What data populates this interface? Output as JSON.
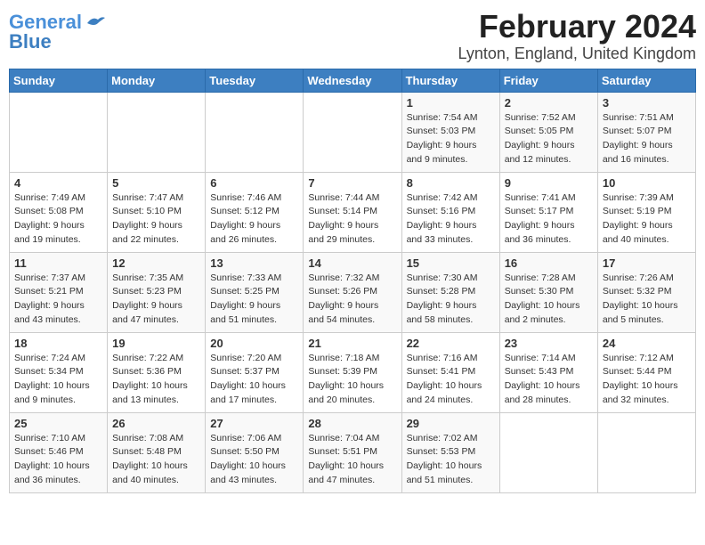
{
  "logo": {
    "line1": "General",
    "line2": "Blue"
  },
  "title": "February 2024",
  "location": "Lynton, England, United Kingdom",
  "days_of_week": [
    "Sunday",
    "Monday",
    "Tuesday",
    "Wednesday",
    "Thursday",
    "Friday",
    "Saturday"
  ],
  "weeks": [
    [
      {
        "day": "",
        "info": ""
      },
      {
        "day": "",
        "info": ""
      },
      {
        "day": "",
        "info": ""
      },
      {
        "day": "",
        "info": ""
      },
      {
        "day": "1",
        "info": "Sunrise: 7:54 AM\nSunset: 5:03 PM\nDaylight: 9 hours\nand 9 minutes."
      },
      {
        "day": "2",
        "info": "Sunrise: 7:52 AM\nSunset: 5:05 PM\nDaylight: 9 hours\nand 12 minutes."
      },
      {
        "day": "3",
        "info": "Sunrise: 7:51 AM\nSunset: 5:07 PM\nDaylight: 9 hours\nand 16 minutes."
      }
    ],
    [
      {
        "day": "4",
        "info": "Sunrise: 7:49 AM\nSunset: 5:08 PM\nDaylight: 9 hours\nand 19 minutes."
      },
      {
        "day": "5",
        "info": "Sunrise: 7:47 AM\nSunset: 5:10 PM\nDaylight: 9 hours\nand 22 minutes."
      },
      {
        "day": "6",
        "info": "Sunrise: 7:46 AM\nSunset: 5:12 PM\nDaylight: 9 hours\nand 26 minutes."
      },
      {
        "day": "7",
        "info": "Sunrise: 7:44 AM\nSunset: 5:14 PM\nDaylight: 9 hours\nand 29 minutes."
      },
      {
        "day": "8",
        "info": "Sunrise: 7:42 AM\nSunset: 5:16 PM\nDaylight: 9 hours\nand 33 minutes."
      },
      {
        "day": "9",
        "info": "Sunrise: 7:41 AM\nSunset: 5:17 PM\nDaylight: 9 hours\nand 36 minutes."
      },
      {
        "day": "10",
        "info": "Sunrise: 7:39 AM\nSunset: 5:19 PM\nDaylight: 9 hours\nand 40 minutes."
      }
    ],
    [
      {
        "day": "11",
        "info": "Sunrise: 7:37 AM\nSunset: 5:21 PM\nDaylight: 9 hours\nand 43 minutes."
      },
      {
        "day": "12",
        "info": "Sunrise: 7:35 AM\nSunset: 5:23 PM\nDaylight: 9 hours\nand 47 minutes."
      },
      {
        "day": "13",
        "info": "Sunrise: 7:33 AM\nSunset: 5:25 PM\nDaylight: 9 hours\nand 51 minutes."
      },
      {
        "day": "14",
        "info": "Sunrise: 7:32 AM\nSunset: 5:26 PM\nDaylight: 9 hours\nand 54 minutes."
      },
      {
        "day": "15",
        "info": "Sunrise: 7:30 AM\nSunset: 5:28 PM\nDaylight: 9 hours\nand 58 minutes."
      },
      {
        "day": "16",
        "info": "Sunrise: 7:28 AM\nSunset: 5:30 PM\nDaylight: 10 hours\nand 2 minutes."
      },
      {
        "day": "17",
        "info": "Sunrise: 7:26 AM\nSunset: 5:32 PM\nDaylight: 10 hours\nand 5 minutes."
      }
    ],
    [
      {
        "day": "18",
        "info": "Sunrise: 7:24 AM\nSunset: 5:34 PM\nDaylight: 10 hours\nand 9 minutes."
      },
      {
        "day": "19",
        "info": "Sunrise: 7:22 AM\nSunset: 5:36 PM\nDaylight: 10 hours\nand 13 minutes."
      },
      {
        "day": "20",
        "info": "Sunrise: 7:20 AM\nSunset: 5:37 PM\nDaylight: 10 hours\nand 17 minutes."
      },
      {
        "day": "21",
        "info": "Sunrise: 7:18 AM\nSunset: 5:39 PM\nDaylight: 10 hours\nand 20 minutes."
      },
      {
        "day": "22",
        "info": "Sunrise: 7:16 AM\nSunset: 5:41 PM\nDaylight: 10 hours\nand 24 minutes."
      },
      {
        "day": "23",
        "info": "Sunrise: 7:14 AM\nSunset: 5:43 PM\nDaylight: 10 hours\nand 28 minutes."
      },
      {
        "day": "24",
        "info": "Sunrise: 7:12 AM\nSunset: 5:44 PM\nDaylight: 10 hours\nand 32 minutes."
      }
    ],
    [
      {
        "day": "25",
        "info": "Sunrise: 7:10 AM\nSunset: 5:46 PM\nDaylight: 10 hours\nand 36 minutes."
      },
      {
        "day": "26",
        "info": "Sunrise: 7:08 AM\nSunset: 5:48 PM\nDaylight: 10 hours\nand 40 minutes."
      },
      {
        "day": "27",
        "info": "Sunrise: 7:06 AM\nSunset: 5:50 PM\nDaylight: 10 hours\nand 43 minutes."
      },
      {
        "day": "28",
        "info": "Sunrise: 7:04 AM\nSunset: 5:51 PM\nDaylight: 10 hours\nand 47 minutes."
      },
      {
        "day": "29",
        "info": "Sunrise: 7:02 AM\nSunset: 5:53 PM\nDaylight: 10 hours\nand 51 minutes."
      },
      {
        "day": "",
        "info": ""
      },
      {
        "day": "",
        "info": ""
      }
    ]
  ]
}
